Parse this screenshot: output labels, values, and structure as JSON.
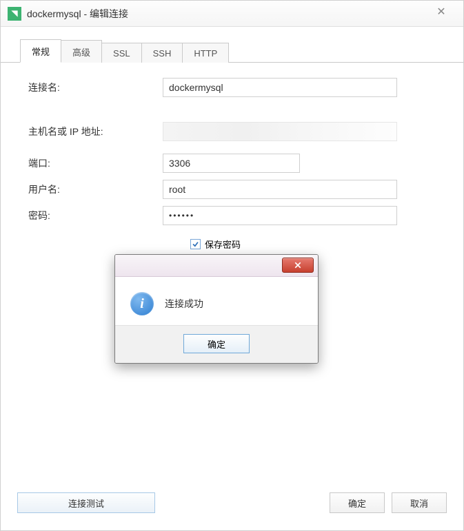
{
  "window": {
    "title": "dockermysql - 编辑连接"
  },
  "tabs": [
    {
      "label": "常规"
    },
    {
      "label": "高级"
    },
    {
      "label": "SSL"
    },
    {
      "label": "SSH"
    },
    {
      "label": "HTTP"
    }
  ],
  "form": {
    "connection_name_label": "连接名:",
    "connection_name_value": "dockermysql",
    "host_label": "主机名或 IP 地址:",
    "host_value": "",
    "port_label": "端口:",
    "port_value": "3306",
    "user_label": "用户名:",
    "user_value": "root",
    "password_label": "密码:",
    "password_value": "••••••",
    "save_password_label": "保存密码"
  },
  "buttons": {
    "test_connection": "连接测试",
    "ok": "确定",
    "cancel": "取消"
  },
  "dialog": {
    "message": "连接成功",
    "ok": "确定",
    "info_glyph": "i"
  }
}
